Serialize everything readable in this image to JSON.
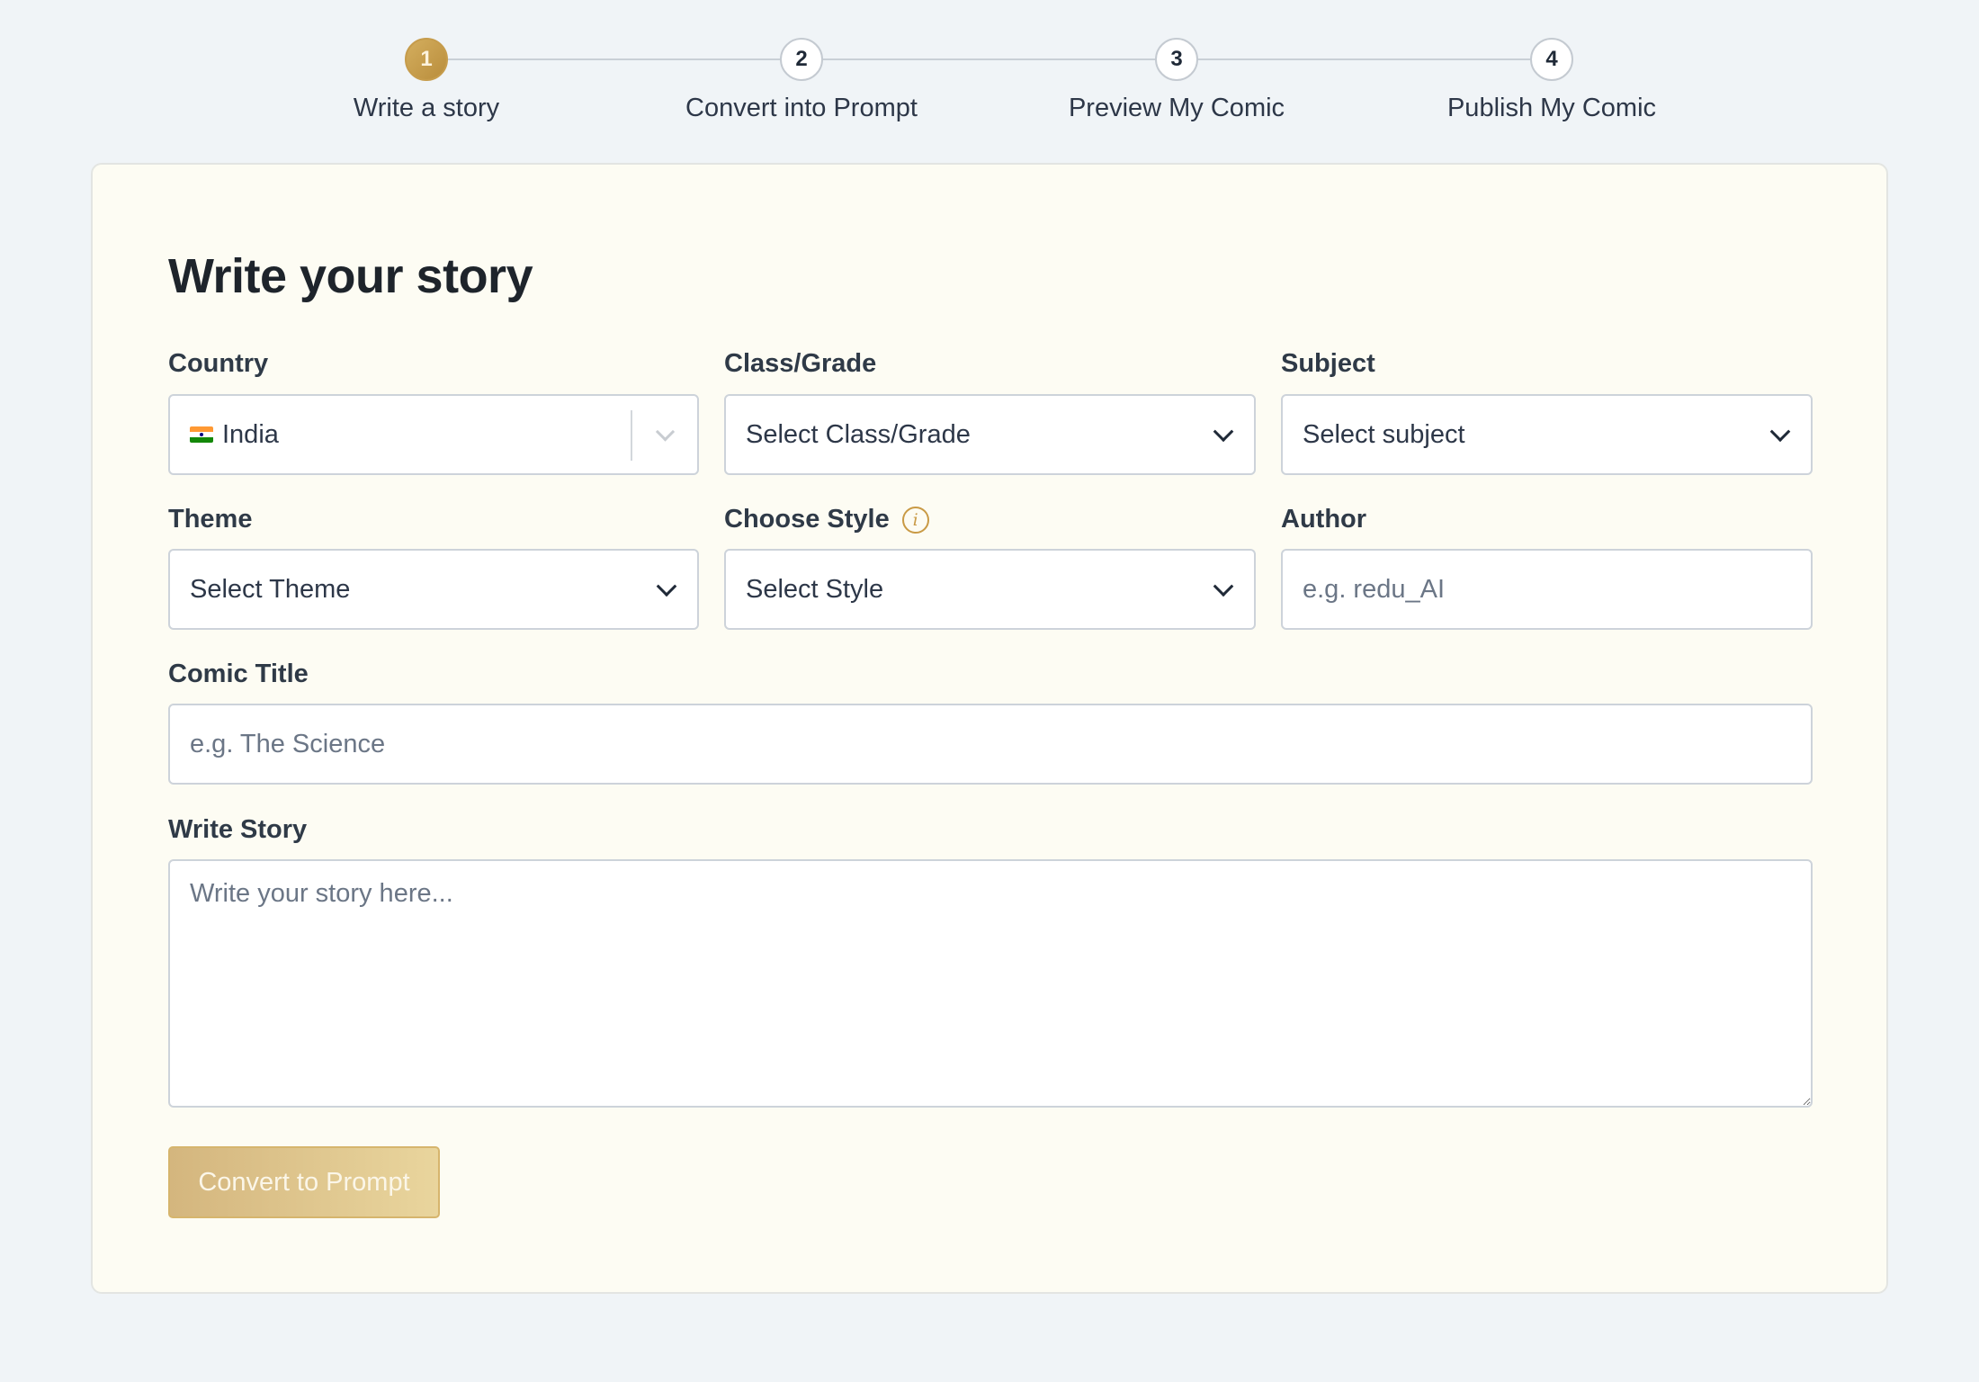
{
  "stepper": {
    "steps": [
      {
        "number": "1",
        "label": "Write a story",
        "active": true
      },
      {
        "number": "2",
        "label": "Convert into Prompt",
        "active": false
      },
      {
        "number": "3",
        "label": "Preview My Comic",
        "active": false
      },
      {
        "number": "4",
        "label": "Publish My Comic",
        "active": false
      }
    ]
  },
  "form": {
    "title": "Write your story",
    "country": {
      "label": "Country",
      "value": "India",
      "flag": "india-flag-icon"
    },
    "class_grade": {
      "label": "Class/Grade",
      "value": "Select Class/Grade"
    },
    "subject": {
      "label": "Subject",
      "value": "Select subject"
    },
    "theme": {
      "label": "Theme",
      "value": "Select Theme"
    },
    "style": {
      "label": "Choose Style",
      "value": "Select Style",
      "info_icon": "info-icon"
    },
    "author": {
      "label": "Author",
      "placeholder": "e.g. redu_AI",
      "value": ""
    },
    "comic_title": {
      "label": "Comic Title",
      "placeholder": "e.g. The Science",
      "value": ""
    },
    "story": {
      "label": "Write Story",
      "placeholder": "Write your story here...",
      "value": ""
    },
    "submit_label": "Convert to Prompt"
  },
  "colors": {
    "accent": "#c99a45",
    "background": "#f0f4f7",
    "card": "#fdfcf3"
  }
}
